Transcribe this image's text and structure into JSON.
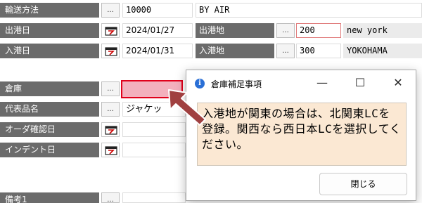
{
  "form": {
    "rows": [
      {
        "label": "輸送方法",
        "value": "10000",
        "value2": "BY AIR"
      },
      {
        "label": "出港日",
        "date": "2024/01/27",
        "sublabel": "出港地",
        "code": "200",
        "name": "new york"
      },
      {
        "label": "入港日",
        "date": "2024/01/31",
        "sublabel": "入港地",
        "code": "300",
        "name": "YOKOHAMA"
      },
      {
        "label": "倉庫"
      },
      {
        "label": "代表品名",
        "value": "ジャケッ"
      },
      {
        "label": "オーダ確認日"
      },
      {
        "label": "インデント日"
      },
      {
        "label": "備考1"
      }
    ],
    "dots_label": "..."
  },
  "dialog": {
    "title": "倉庫補足事項",
    "minimize": "—",
    "maximize": "☐",
    "close": "✕",
    "info_glyph": "i",
    "message": "入港地が関東の場合は、北関東LCを登録。関西なら西日本LCを選択してください。",
    "close_button": "閉じる"
  },
  "colors": {
    "label_bg": "#6b6b6b",
    "highlight_field": "#f3b0bd",
    "highlight_border": "#e0001b",
    "message_bg": "#fbe8d3",
    "arrow": "#a04040"
  },
  "icons": [
    "calendar-icon",
    "info-icon",
    "arrow-icon"
  ]
}
